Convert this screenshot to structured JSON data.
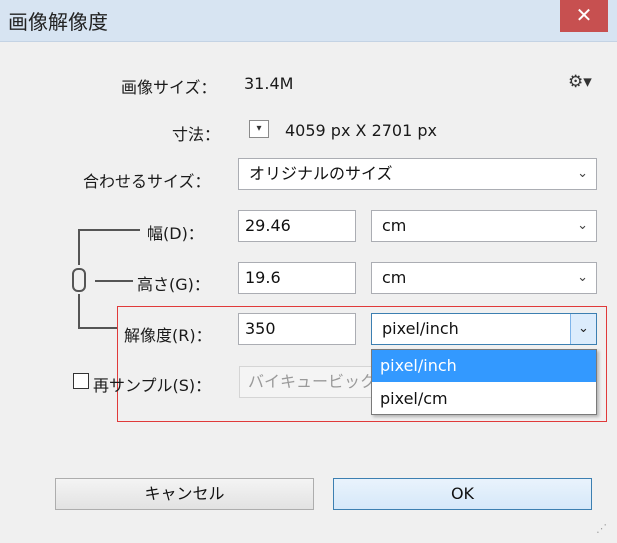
{
  "window": {
    "title": "画像解像度",
    "close_glyph": "✕"
  },
  "image_size": {
    "label": "画像サイズ：",
    "value": "31.4M",
    "gear_glyph": "⚙▾"
  },
  "dimensions": {
    "label": "寸法：",
    "toggle_glyph": "▾",
    "value": "4059 px  X  2701 px"
  },
  "fit_to": {
    "label": "合わせるサイズ：",
    "value": "オリジナルのサイズ",
    "chevron": "⌄"
  },
  "width": {
    "label": "幅(D)：",
    "value": "29.46",
    "unit": "cm",
    "chevron": "⌄"
  },
  "height": {
    "label": "高さ(G)：",
    "value": "19.6",
    "unit": "cm",
    "chevron": "⌄"
  },
  "resolution": {
    "label": "解像度(R)：",
    "value": "350",
    "unit": "pixel/inch",
    "chevron": "⌄",
    "options": [
      "pixel/inch",
      "pixel/cm"
    ]
  },
  "resample": {
    "label": "再サンプル(S)：",
    "checked": false,
    "value": "バイキュービック"
  },
  "buttons": {
    "cancel": "キャンセル",
    "ok": "OK"
  },
  "icons": {
    "gear": "gear-icon",
    "chain": "chain-link-icon",
    "close": "close-icon",
    "grip": "resize-grip-icon"
  },
  "colors": {
    "highlight_border": "#e03a3a",
    "selection": "#3399ff",
    "close_button": "#c75050"
  }
}
